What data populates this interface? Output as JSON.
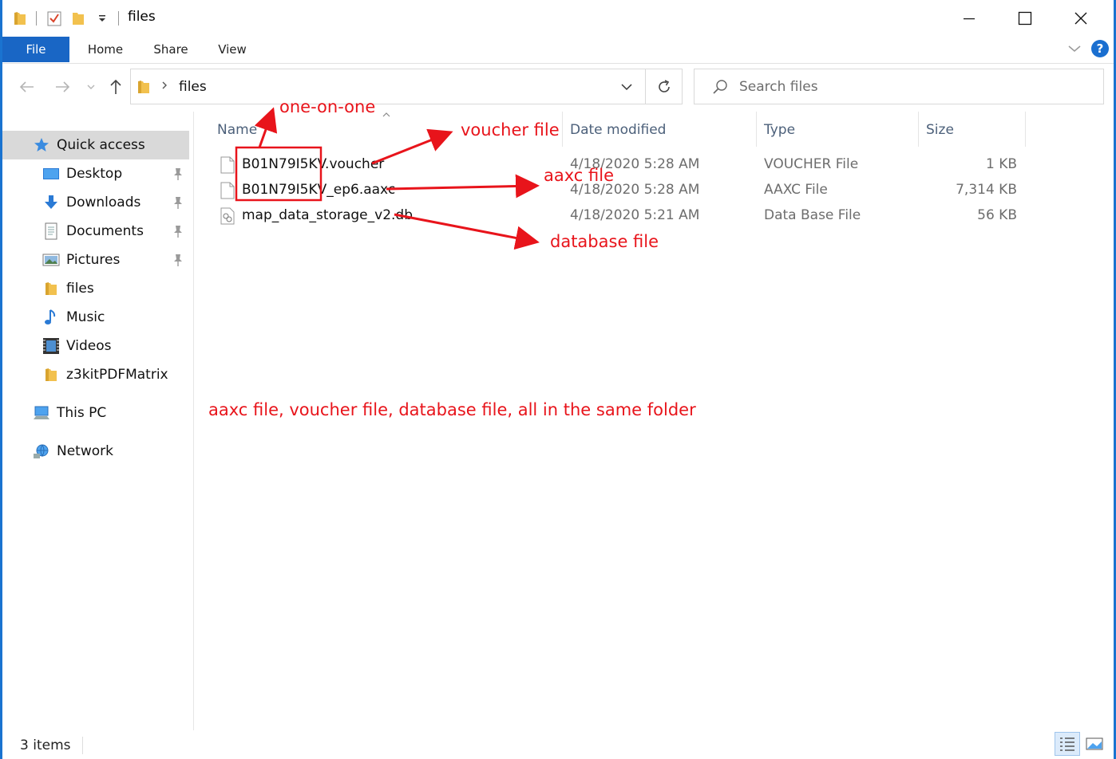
{
  "window": {
    "title": "files",
    "colors": {
      "accent": "#1966c5",
      "annotation": "#e8141b",
      "selected": "#d9d9d9"
    }
  },
  "ribbon": {
    "tabs": [
      {
        "label": "File"
      },
      {
        "label": "Home"
      },
      {
        "label": "Share"
      },
      {
        "label": "View"
      }
    ],
    "help_label": "?"
  },
  "address": {
    "path": "files",
    "search_placeholder": "Search files"
  },
  "nav": {
    "quick_access": "Quick access",
    "items": [
      {
        "label": "Desktop",
        "icon": "desktop-icon",
        "pinned": true
      },
      {
        "label": "Downloads",
        "icon": "downloads-icon",
        "pinned": true
      },
      {
        "label": "Documents",
        "icon": "documents-icon",
        "pinned": true
      },
      {
        "label": "Pictures",
        "icon": "pictures-icon",
        "pinned": true
      },
      {
        "label": "files",
        "icon": "folder-icon",
        "pinned": false
      },
      {
        "label": "Music",
        "icon": "music-icon",
        "pinned": false
      },
      {
        "label": "Videos",
        "icon": "videos-icon",
        "pinned": false
      },
      {
        "label": "z3kitPDFMatrix",
        "icon": "folder-icon",
        "pinned": false
      }
    ],
    "this_pc": "This PC",
    "network": "Network"
  },
  "columns": {
    "name": "Name",
    "date": "Date modified",
    "type": "Type",
    "size": "Size"
  },
  "files": [
    {
      "name": "B01N79I5KV.voucher",
      "date": "4/18/2020 5:28 AM",
      "type": "VOUCHER File",
      "size": "1 KB"
    },
    {
      "name": "B01N79I5KV_ep6.aaxc",
      "date": "4/18/2020 5:28 AM",
      "type": "AAXC File",
      "size": "7,314 KB"
    },
    {
      "name": "map_data_storage_v2.db",
      "date": "4/18/2020 5:21 AM",
      "type": "Data Base File",
      "size": "56 KB"
    }
  ],
  "status": {
    "items_count": "3 items"
  },
  "annotations": {
    "one_on_one": "one-on-one",
    "voucher": "voucher file",
    "aaxc": "aaxc file",
    "database": "database file",
    "summary": "aaxc file, voucher file, database file, all in the same folder"
  }
}
